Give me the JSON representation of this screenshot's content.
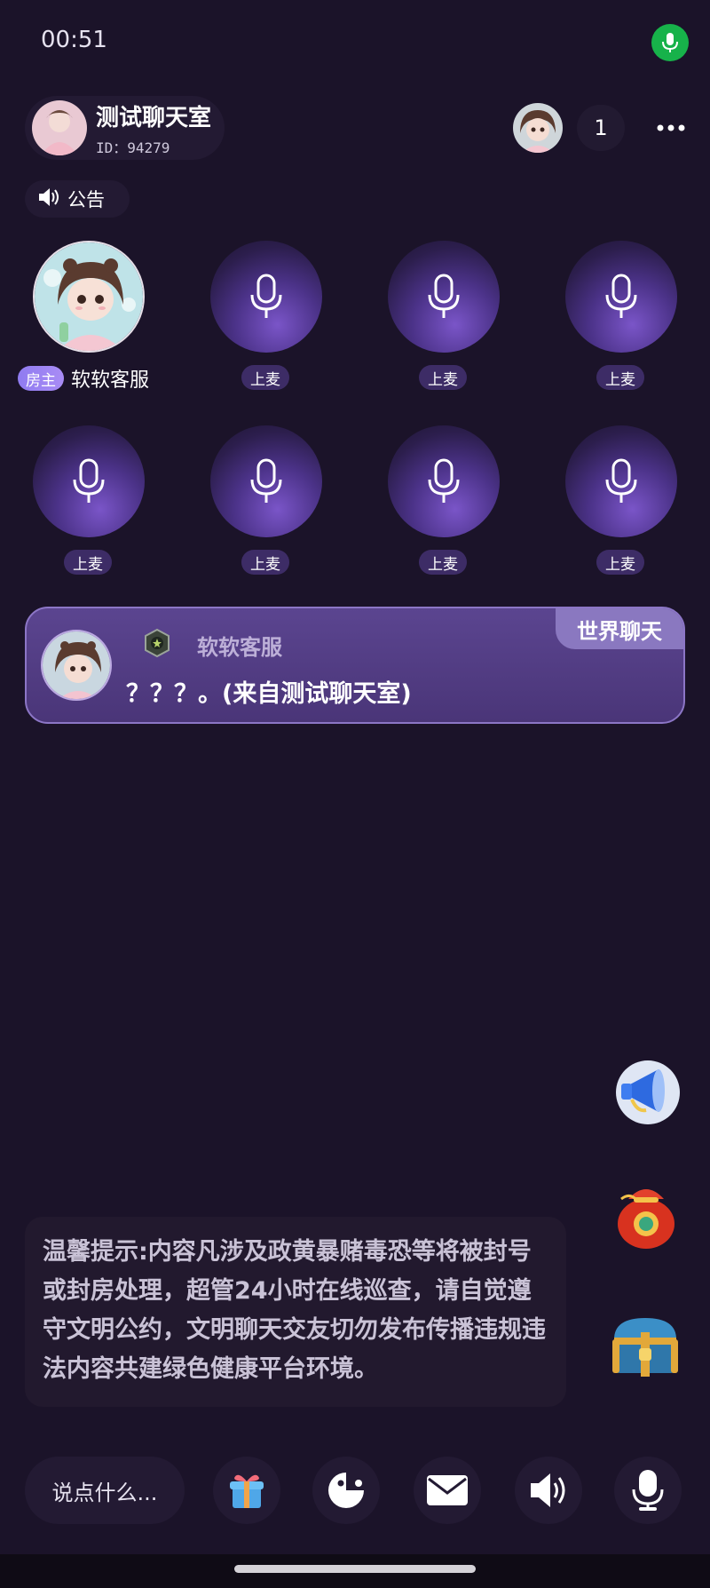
{
  "status_bar": {
    "time": "00:51",
    "mic_icon": "microphone-icon",
    "mic_color": "#17b24a"
  },
  "room": {
    "title": "测试聊天室",
    "id_text": "ID：94279",
    "online_count": "1"
  },
  "announcement": {
    "label": "公告"
  },
  "host": {
    "badge": "房主",
    "name": "软软客服"
  },
  "seats": [
    {
      "label": "上麦"
    },
    {
      "label": "上麦"
    },
    {
      "label": "上麦"
    },
    {
      "label": "上麦"
    },
    {
      "label": "上麦"
    },
    {
      "label": "上麦"
    },
    {
      "label": "上麦"
    },
    {
      "label": "上麦"
    }
  ],
  "world_chat": {
    "tag": "世界聊天",
    "sender": "软软客服",
    "message": "？？？。(来自测试聊天室)"
  },
  "tip": {
    "text": "温馨提示:内容凡涉及政黄暴赌毒恐等将被封号或封房处理，超管24小时在线巡查，请自觉遵守文明公约，文明聊天交友切勿发布传播违规违法内容共建绿色健康平台环境。"
  },
  "bottom_bar": {
    "input_placeholder": "说点什么...",
    "buttons": [
      "gift-icon",
      "game-icon",
      "mail-icon",
      "speaker-icon",
      "microphone-icon"
    ]
  },
  "side_buttons": [
    "megaphone-icon",
    "lucky-bag-icon",
    "treasure-chest-icon"
  ],
  "colors": {
    "background": "#1b1329",
    "card": "#4a3578",
    "accent": "#8a78c0"
  }
}
